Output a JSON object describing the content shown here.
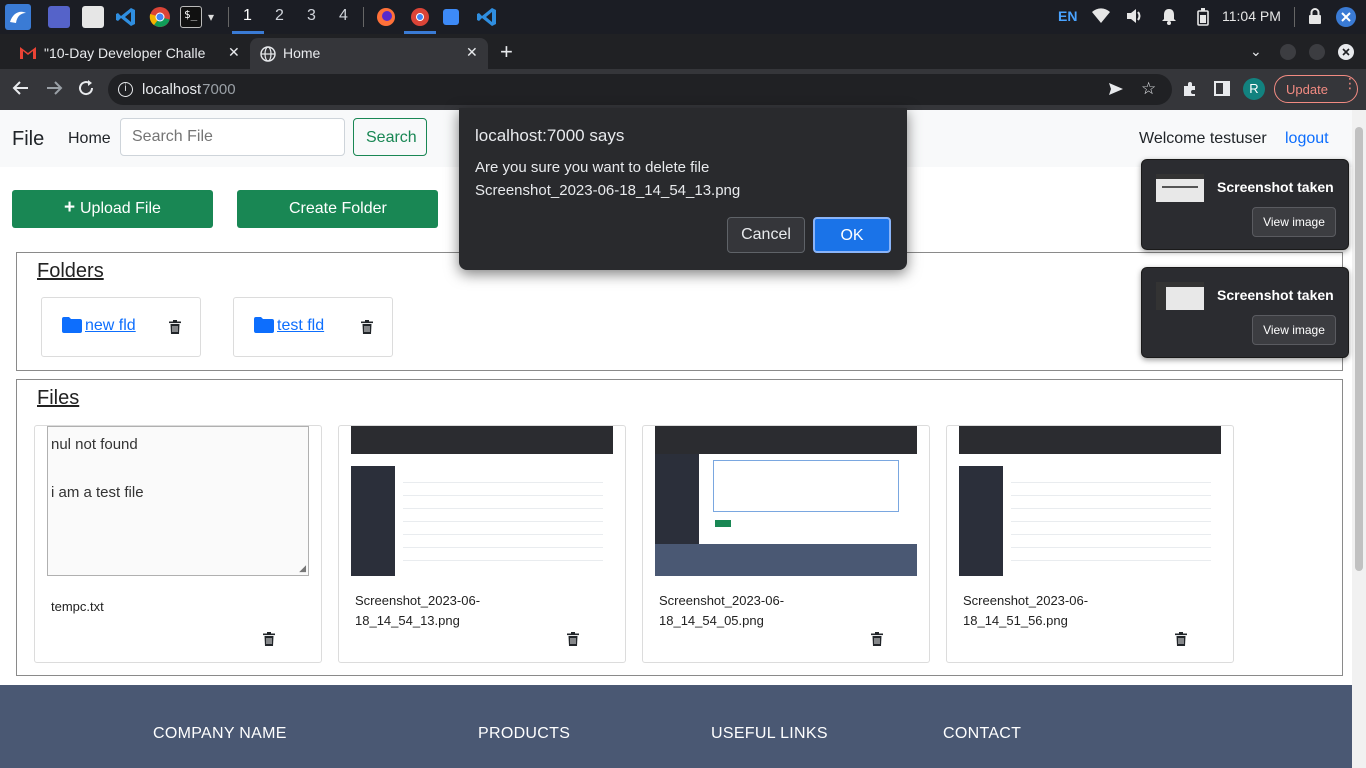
{
  "taskbar": {
    "workspaces": [
      "1",
      "2",
      "3",
      "4"
    ],
    "language": "EN",
    "time": "11:04 PM"
  },
  "browser": {
    "tabs": [
      {
        "title": "\"10-Day Developer Challe",
        "favicon": "gmail-icon"
      },
      {
        "title": "Home",
        "favicon": "globe-icon"
      }
    ],
    "address": {
      "host": "localhost",
      "port": ":7000"
    },
    "profile_initial": "R",
    "update_label": "Update"
  },
  "navbar": {
    "brand": "File",
    "home_link": "Home",
    "search_placeholder": "Search File",
    "search_button": "Search",
    "welcome": "Welcome testuser",
    "logout": "logout"
  },
  "actions": {
    "upload_label": "Upload File",
    "create_folder_label": "Create Folder"
  },
  "folders": {
    "title": "Folders",
    "items": [
      {
        "name": "new fld"
      },
      {
        "name": "test fld"
      }
    ]
  },
  "files": {
    "title": "Files",
    "text_preview": {
      "line1": "nul not found",
      "line2": "i am a test file"
    },
    "items": [
      {
        "name": "tempc.txt"
      },
      {
        "name_line1": "Screenshot_2023-06-",
        "name_line2": "18_14_54_13.png"
      },
      {
        "name_line1": "Screenshot_2023-06-",
        "name_line2": "18_14_54_05.png"
      },
      {
        "name_line1": "Screenshot_2023-06-",
        "name_line2": "18_14_51_56.png"
      }
    ]
  },
  "footer": {
    "columns": [
      "COMPANY NAME",
      "PRODUCTS",
      "USEFUL LINKS",
      "CONTACT"
    ]
  },
  "dialog": {
    "title": "localhost:7000 says",
    "message_line1": "Are you sure you want to delete file",
    "message_line2": "Screenshot_2023-06-18_14_54_13.png",
    "cancel": "Cancel",
    "ok": "OK"
  },
  "toasts": [
    {
      "title": "Screenshot taken",
      "button": "View image"
    },
    {
      "title": "Screenshot taken",
      "button": "View image"
    }
  ],
  "colors": {
    "accent_green": "#198754",
    "link_blue": "#0d6efd",
    "dialog_ok": "#1a73e8",
    "footer_bg": "#4a5873"
  }
}
